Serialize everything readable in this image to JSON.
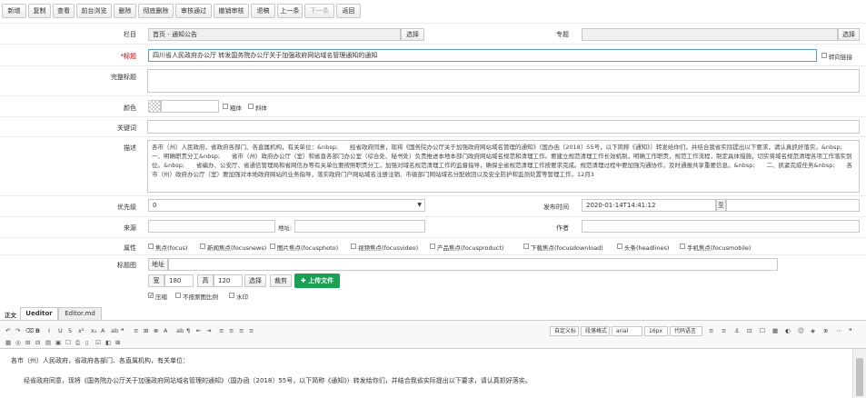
{
  "toolbar": [
    {
      "label": "新增",
      "enabled": true
    },
    {
      "label": "复制",
      "enabled": true
    },
    {
      "label": "查看",
      "enabled": true
    },
    {
      "label": "前台浏览",
      "enabled": true
    },
    {
      "label": "删除",
      "enabled": true
    },
    {
      "label": "彻底删除",
      "enabled": true
    },
    {
      "label": "审核通过",
      "enabled": true
    },
    {
      "label": "撤销审核",
      "enabled": true
    },
    {
      "label": "退稿",
      "enabled": true
    },
    {
      "label": "上一条",
      "enabled": true
    },
    {
      "label": "下一条",
      "enabled": false
    },
    {
      "label": "返回",
      "enabled": true
    }
  ],
  "form": {
    "column_label": "栏目",
    "column_value": "首页 - 通知公告",
    "select_label": "选择",
    "topic_label": "专题",
    "topic_select_label": "选择",
    "title_label": "*标题",
    "title_value": "四川省人民政府办公厅 转发国务院办公厅关于加强政府网站域名管理通知的通知",
    "redirect_label": "转向链接",
    "full_title_label": "完整标题",
    "color_label": "颜色",
    "bold_label": "粗体",
    "italic_label": "斜体",
    "keywords_label": "关键词",
    "desc_label": "描述",
    "desc_value": "各市（州）人民政府，省政府各部门、各直属机构，有关单位：&nbsp;　　经省政府同意，现将《国务院办公厅关于加强政府网站域名管理的通知》（国办函〔2018〕55号，以下简称《通知》）转发给你们，并结合我省实际提出以下要求，请认真抓好落实。&nbsp;　　一、明确职责分工&nbsp;　　省市（州）政府办公厅（室）和省直各部门办公室（综合处、秘书处）负责推进本地本部门政府网站域名规范和清理工作。要建立规范清理工作长效机制，明确工作职责，规范工作流程，制定具体措施，切实将域名规范清理各项工作落实到位。&nbsp;　　省编办、公安厅、省通信管理局和省网信办等有关单位要按照职责分工，加强对域名规范清理工作的监督指导，确保全省规范清理工作按要求完成。规范清理过程中要加强沟通协作，及时通报共享重要信息。&nbsp;　　二、抓紧完成任务&nbsp;　　各市（州）政府办公厅（室）要加强对本地政府网站的业务指导，落实政府门户网站域名注册注销、市级部门网站域名分配收回以及安全防护和监测处置等管理工作，12月3",
    "priority_label": "优先级",
    "priority_value": "0",
    "publish_label": "发布时间",
    "publish_value": "2020-01-14T14:41:12",
    "to_label": "至",
    "source_label": "来源",
    "address_label": "地址:",
    "author_label": "作者",
    "attr_label": "属性",
    "attrs": [
      "焦点(focus)",
      "新闻焦点(focusnews)",
      "图片焦点(focusphoto)",
      "视频焦点(focusvideo)",
      "产品焦点(focusproduct)",
      "下载焦点(focusdownload)",
      "头条(headlines)",
      "手机焦点(focusmobile)"
    ],
    "thumb_label": "标题图",
    "thumb_addr_label": "地址",
    "width_label": "宽",
    "width_value": "180",
    "height_label": "高",
    "height_value": "120",
    "thumb_select": "选择",
    "crop_label": "裁剪",
    "upload_label": "上传文件",
    "compress_label": "压缩",
    "keep_ratio_label": "不按原图比例",
    "watermark_label": "水印"
  },
  "editor": {
    "body_label": "正文",
    "tabs": [
      "Ueditor",
      "Editor.md"
    ],
    "dd_custom": "自定义标",
    "dd_para": "段落格式",
    "dd_font": "arial",
    "dd_size": "16px",
    "dd_lang": "代码语言",
    "content_line1": "各市（州）人民政府，省政府各部门、各直属机构，有关单位：",
    "content_line2": "经省政府同意，现将《国务院办公厅关于加强政府网站域名管理的通知》（国办函〔2018〕55号，以下简称《通知》）转发给你们，并结合我省实际提出以下要求，请认真抓好落实。"
  },
  "colors": {
    "accent": "#1aa053",
    "focus": "#5b9bd5"
  }
}
